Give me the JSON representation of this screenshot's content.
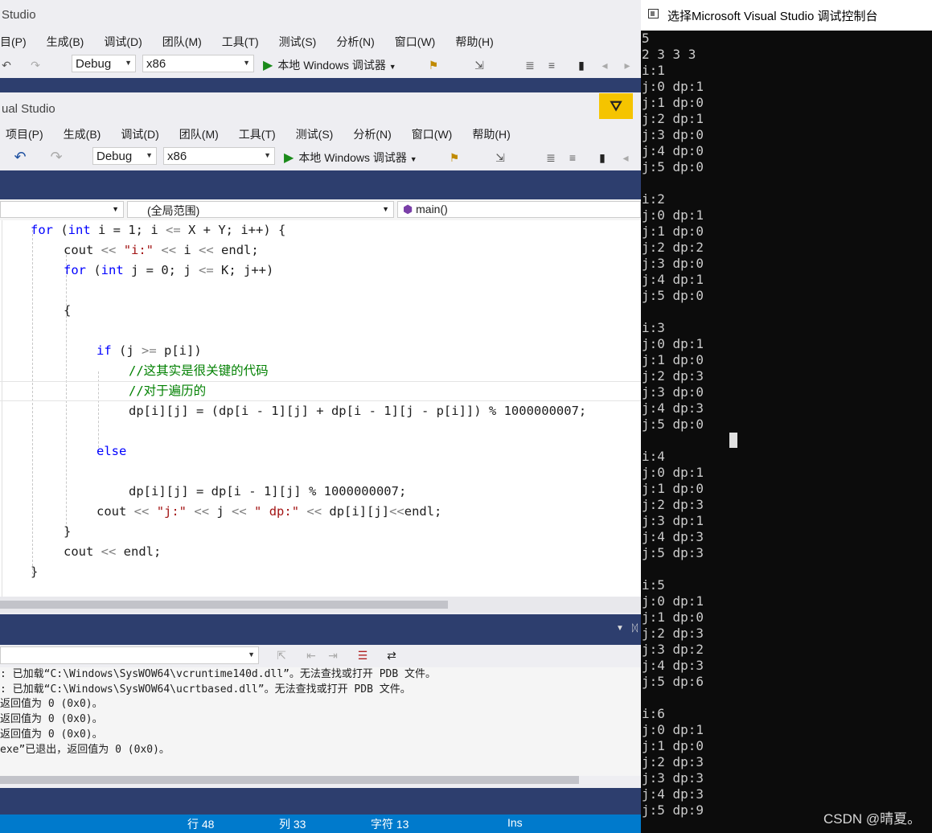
{
  "back_window": {
    "title": "Studio",
    "menu": [
      "目(P)",
      "生成(B)",
      "调试(D)",
      "团队(M)",
      "工具(T)",
      "测试(S)",
      "分析(N)",
      "窗口(W)",
      "帮助(H)"
    ],
    "config": "Debug",
    "platform": "x86",
    "debugger": "本地 Windows 调试器"
  },
  "front_window": {
    "title": "ual Studio",
    "menu": [
      "项目(P)",
      "生成(B)",
      "调试(D)",
      "团队(M)",
      "工具(T)",
      "测试(S)",
      "分析(N)",
      "窗口(W)",
      "帮助(H)"
    ],
    "config": "Debug",
    "platform": "x86",
    "debugger": "本地 Windows 调试器"
  },
  "navbar": {
    "scope": "(全局范围)",
    "function": "main()"
  },
  "code": {
    "l1": [
      "for",
      " (",
      "int",
      " i = 1; i ",
      "<=",
      " X + Y; i++) {"
    ],
    "l2": [
      "cout ",
      "<<",
      " ",
      "\"i:\"",
      " ",
      "<<",
      " i ",
      "<<",
      " endl;"
    ],
    "l3": [
      "for",
      " (",
      "int",
      " j = 0; j ",
      "<=",
      " K; j++)"
    ],
    "l4": "{",
    "l5": [
      "if",
      " (j ",
      ">=",
      " p[i])"
    ],
    "l6": "//这其实是很关键的代码",
    "l7": "//对于遍历的",
    "l8": "dp[i][j] = (dp[i - 1][j] + dp[i - 1][j - p[i]]) % 1000000007;",
    "l9": "else",
    "l10": "dp[i][j] = dp[i - 1][j] % 1000000007;",
    "l11": [
      "cout ",
      "<<",
      " ",
      "\"j:\"",
      " ",
      "<<",
      " j ",
      "<<",
      " ",
      "\" dp:\"",
      " ",
      "<<",
      " dp[i][j]",
      "<<",
      "endl;"
    ],
    "l12": "}",
    "l13": [
      "cout ",
      "<<",
      " endl;"
    ],
    "l14": "}"
  },
  "output": {
    "lines": [
      ": 已加载“C:\\Windows\\SysWOW64\\vcruntime140d.dll”。无法查找或打开 PDB 文件。",
      ": 已加载“C:\\Windows\\SysWOW64\\ucrtbased.dll”。无法查找或打开 PDB 文件。",
      "返回值为 0 (0x0)。",
      "返回值为 0 (0x0)。",
      "返回值为 0 (0x0)。",
      "exe”已退出，返回值为 0 (0x0)。"
    ]
  },
  "statusbar": {
    "line": "行 48",
    "col": "列 33",
    "ch": "字符 13",
    "mode": "Ins"
  },
  "console": {
    "title": "选择Microsoft Visual Studio 调试控制台",
    "text": "5\n2 3 3 3\ni:1\nj:0 dp:1\nj:1 dp:0\nj:2 dp:1\nj:3 dp:0\nj:4 dp:0\nj:5 dp:0\n\ni:2\nj:0 dp:1\nj:1 dp:0\nj:2 dp:2\nj:3 dp:0\nj:4 dp:1\nj:5 dp:0\n\ni:3\nj:0 dp:1\nj:1 dp:0\nj:2 dp:3\nj:3 dp:0\nj:4 dp:3\nj:5 dp:0\n\ni:4\nj:0 dp:1\nj:1 dp:0\nj:2 dp:3\nj:3 dp:1\nj:4 dp:3\nj:5 dp:3\n\ni:5\nj:0 dp:1\nj:1 dp:0\nj:2 dp:3\nj:3 dp:2\nj:4 dp:3\nj:5 dp:6\n\ni:6\nj:0 dp:1\nj:1 dp:0\nj:2 dp:3\nj:3 dp:3\nj:4 dp:3\nj:5 dp:9"
  },
  "watermark": "CSDN @晴夏。"
}
